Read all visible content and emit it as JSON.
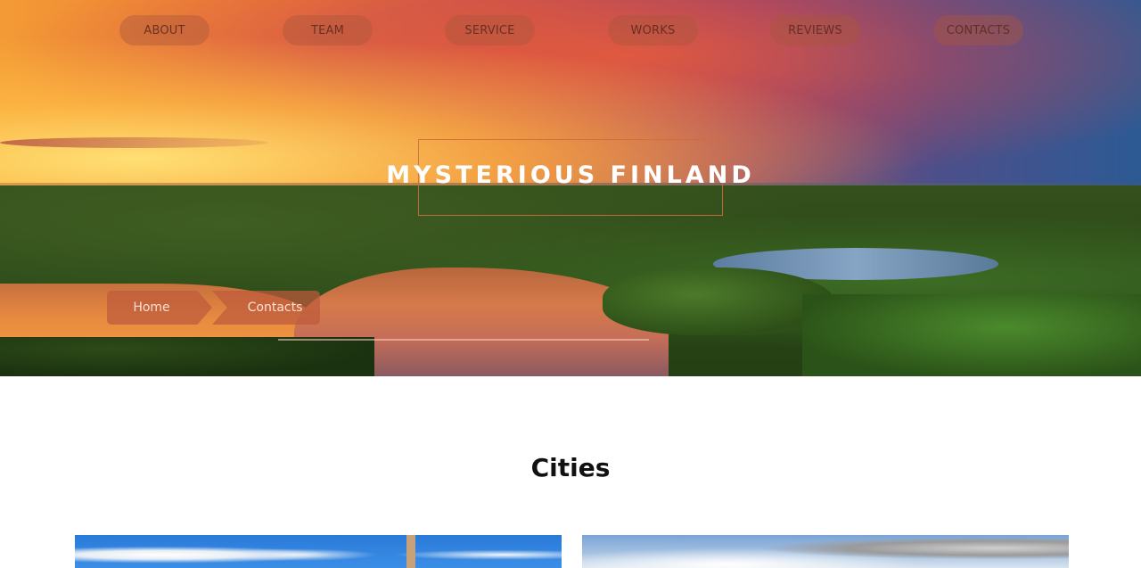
{
  "nav": {
    "items": [
      {
        "label": "ABOUT"
      },
      {
        "label": "TEAM"
      },
      {
        "label": "SERVICE"
      },
      {
        "label": "WORKS"
      },
      {
        "label": "REVIEWS"
      },
      {
        "label": "CONTACTS"
      }
    ]
  },
  "hero": {
    "title": "MYSTERIOUS FINLAND",
    "breadcrumb": {
      "home": "Home",
      "current": "Contacts"
    }
  },
  "section": {
    "title": "Cities"
  },
  "colors": {
    "nav_pill": "#aa553c",
    "title_frame": "#cd6e3c",
    "breadcrumb": "#be5a3c"
  }
}
